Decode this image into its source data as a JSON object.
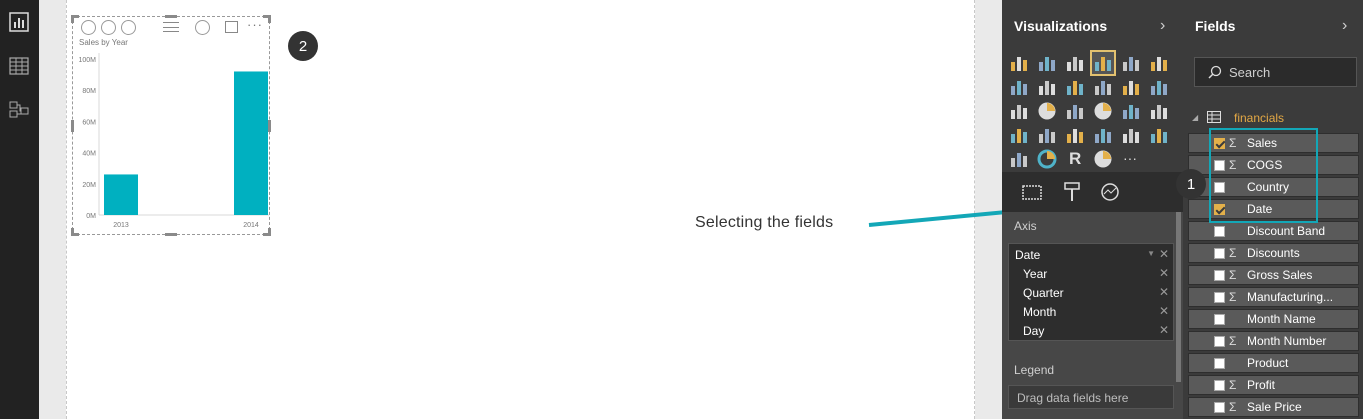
{
  "report": {
    "left_nav": [
      {
        "icon": "report-view-icon",
        "active": true
      },
      {
        "icon": "data-view-icon",
        "active": false
      },
      {
        "icon": "relationships-view-icon",
        "active": false
      }
    ]
  },
  "visual": {
    "title": "Sales by Year",
    "toolbar_icons": [
      "drill-up-icon",
      "drill-down-all-icon",
      "expand-all-icon",
      "drag-grip-icon",
      "drill-mode-icon",
      "focus-mode-icon",
      "more-options-icon"
    ]
  },
  "chart_data": {
    "type": "bar",
    "title": "Sales by Year",
    "categories": [
      "2013",
      "2014"
    ],
    "values": [
      26,
      92
    ],
    "ylim": [
      0,
      100
    ],
    "yticks": [
      "0M",
      "20M",
      "40M",
      "60M",
      "80M",
      "100M"
    ],
    "ylabel": "",
    "xlabel": "",
    "color": "#00b0c0",
    "grid": false
  },
  "badges": {
    "two": "2",
    "one": "1"
  },
  "annotation": {
    "text": "Selecting the fields",
    "arrow_color": "#13a7b7"
  },
  "visualizations": {
    "title": "Visualizations",
    "chevron": "›",
    "icons": [
      "stacked-bar-icon",
      "stacked-column-icon",
      "clustered-bar-icon",
      "clustered-column-icon",
      "100-stacked-bar-icon",
      "100-stacked-column-icon",
      "line-chart-icon",
      "area-chart-icon",
      "stacked-area-icon",
      "line-column-icon",
      "line-clustered-column-icon",
      "ribbon-chart-icon",
      "scatter-chart-icon",
      "pie-chart-icon",
      "treemap-icon",
      "map-icon",
      "table-icon",
      "matrix-icon",
      "filled-map-icon",
      "funnel-icon",
      "gauge-icon",
      "multi-row-card-icon",
      "card-icon",
      "kpi-icon",
      "slicer-icon",
      "donut-icon",
      "r-visual-icon",
      "globe-icon",
      "more-visuals-icon"
    ],
    "tabs": [
      "fields-tab-icon",
      "format-tab-icon",
      "analytics-tab-icon"
    ],
    "axis": {
      "label": "Axis",
      "field": "Date",
      "hierarchy": [
        "Year",
        "Quarter",
        "Month",
        "Day"
      ]
    },
    "legend": {
      "label": "Legend",
      "placeholder": "Drag data fields here"
    }
  },
  "fields": {
    "title": "Fields",
    "chevron": "›",
    "search_placeholder": "Search",
    "table": "financials",
    "items": [
      {
        "name": "Sales",
        "checked": true,
        "sigma": true
      },
      {
        "name": "COGS",
        "checked": false,
        "sigma": true
      },
      {
        "name": "Country",
        "checked": false,
        "sigma": false
      },
      {
        "name": "Date",
        "checked": true,
        "sigma": false
      },
      {
        "name": "Discount Band",
        "checked": false,
        "sigma": false
      },
      {
        "name": "Discounts",
        "checked": false,
        "sigma": true
      },
      {
        "name": "Gross Sales",
        "checked": false,
        "sigma": true
      },
      {
        "name": "Manufacturing...",
        "checked": false,
        "sigma": true
      },
      {
        "name": "Month Name",
        "checked": false,
        "sigma": false
      },
      {
        "name": "Month Number",
        "checked": false,
        "sigma": true
      },
      {
        "name": "Product",
        "checked": false,
        "sigma": false
      },
      {
        "name": "Profit",
        "checked": false,
        "sigma": true
      },
      {
        "name": "Sale Price",
        "checked": false,
        "sigma": true
      }
    ]
  }
}
